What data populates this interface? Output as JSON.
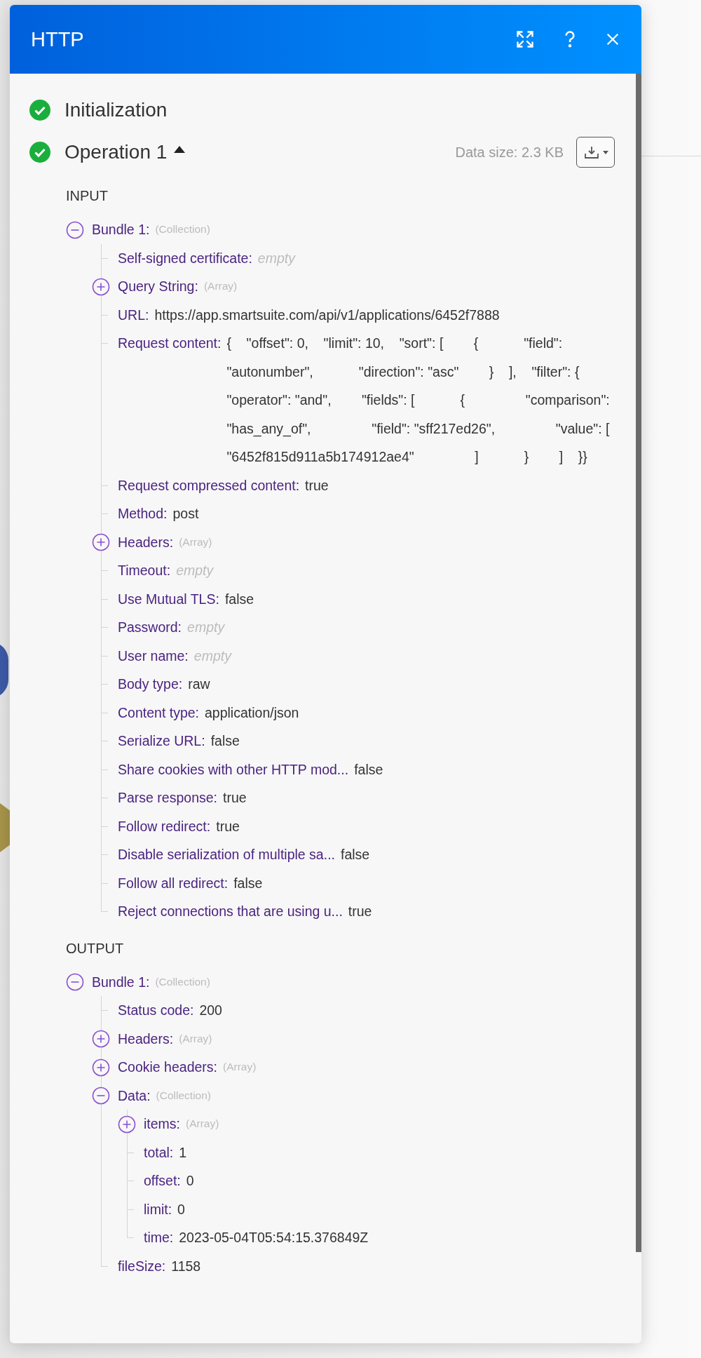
{
  "window": {
    "title": "HTTP"
  },
  "stages": [
    {
      "label": "Initialization",
      "success": true
    },
    {
      "label": "Operation 1",
      "success": true,
      "expanded": true,
      "data_size": "Data size: 2.3 KB"
    }
  ],
  "sections": [
    {
      "heading": "INPUT",
      "tree": [
        {
          "kind": "collection",
          "label": "Bundle 1:",
          "type": "(Collection)",
          "expanded": true,
          "children": [
            {
              "kind": "field",
              "label": "Self-signed certificate:",
              "placeholder": "empty"
            },
            {
              "kind": "array",
              "label": "Query String:",
              "type": "(Array)",
              "expanded": false
            },
            {
              "kind": "field",
              "label": "URL:",
              "value": "https://app.smartsuite.com/api/v1/applications/6452f7888"
            },
            {
              "kind": "field",
              "label": "Request content:",
              "value": "{    \"offset\": 0,    \"limit\": 10,    \"sort\": [        {            \"field\": \"autonumber\",            \"direction\": \"asc\"        }    ],    \"filter\": {        \"operator\": \"and\",        \"fields\": [            {                \"comparison\": \"has_any_of\",                \"field\": \"sff217ed26\",                \"value\": [                    \"6452f815d911a5b174912ae4\"                ]            }        ]    }}"
            },
            {
              "kind": "field",
              "label": "Request compressed content:",
              "value": "true"
            },
            {
              "kind": "field",
              "label": "Method:",
              "value": "post"
            },
            {
              "kind": "array",
              "label": "Headers:",
              "type": "(Array)",
              "expanded": false
            },
            {
              "kind": "field",
              "label": "Timeout:",
              "placeholder": "empty"
            },
            {
              "kind": "field",
              "label": "Use Mutual TLS:",
              "value": "false"
            },
            {
              "kind": "field",
              "label": "Password:",
              "placeholder": "empty"
            },
            {
              "kind": "field",
              "label": "User name:",
              "placeholder": "empty"
            },
            {
              "kind": "field",
              "label": "Body type:",
              "value": "raw"
            },
            {
              "kind": "field",
              "label": "Content type:",
              "value": "application/json"
            },
            {
              "kind": "field",
              "label": "Serialize URL:",
              "value": "false"
            },
            {
              "kind": "field",
              "label": "Share cookies with other HTTP mod...",
              "value": "false"
            },
            {
              "kind": "field",
              "label": "Parse response:",
              "value": "true"
            },
            {
              "kind": "field",
              "label": "Follow redirect:",
              "value": "true"
            },
            {
              "kind": "field",
              "label": "Disable serialization of multiple sa...",
              "value": "false"
            },
            {
              "kind": "field",
              "label": "Follow all redirect:",
              "value": "false"
            },
            {
              "kind": "field",
              "label": "Reject connections that are using u...",
              "value": "true"
            }
          ]
        }
      ]
    },
    {
      "heading": "OUTPUT",
      "tree": [
        {
          "kind": "collection",
          "label": "Bundle 1:",
          "type": "(Collection)",
          "expanded": true,
          "children": [
            {
              "kind": "field",
              "label": "Status code:",
              "value": "200"
            },
            {
              "kind": "array",
              "label": "Headers:",
              "type": "(Array)",
              "expanded": false
            },
            {
              "kind": "array",
              "label": "Cookie headers:",
              "type": "(Array)",
              "expanded": false
            },
            {
              "kind": "collection",
              "label": "Data:",
              "type": "(Collection)",
              "expanded": true,
              "children": [
                {
                  "kind": "array",
                  "label": "items:",
                  "type": "(Array)",
                  "expanded": false
                },
                {
                  "kind": "field",
                  "label": "total:",
                  "value": "1"
                },
                {
                  "kind": "field",
                  "label": "offset:",
                  "value": "0"
                },
                {
                  "kind": "field",
                  "label": "limit:",
                  "value": "0"
                },
                {
                  "kind": "field",
                  "label": "time:",
                  "value": "2023-05-04T05:54:15.376849Z"
                }
              ]
            },
            {
              "kind": "field",
              "label": "fileSize:",
              "value": "1158"
            }
          ]
        }
      ]
    }
  ]
}
